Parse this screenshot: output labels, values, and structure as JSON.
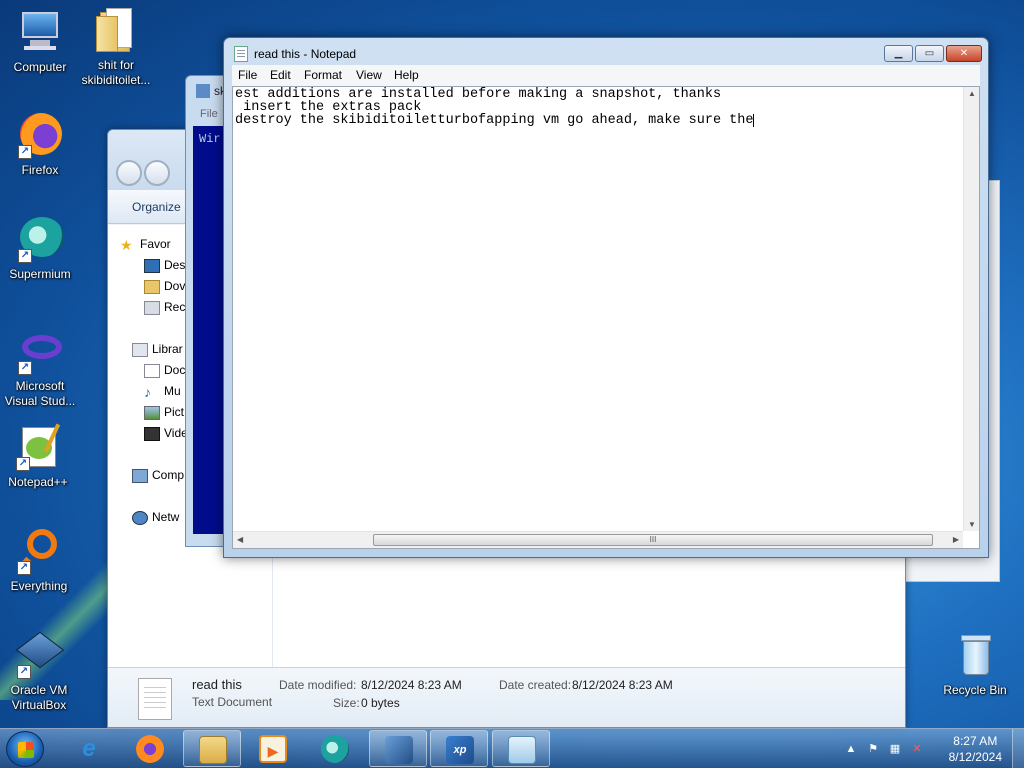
{
  "desktop": {
    "icons": [
      {
        "label": "Computer",
        "icon": "computer-icon"
      },
      {
        "label": "shit for skibiditoilet...",
        "icon": "folder-icon"
      },
      {
        "label": "Firefox",
        "icon": "firefox-icon"
      },
      {
        "label": "Supermium",
        "icon": "supermium-icon"
      },
      {
        "label": "Microsoft Visual Stud...",
        "icon": "visual-studio-icon"
      },
      {
        "label": "Notepad++",
        "icon": "notepadpp-icon"
      },
      {
        "label": "Everything",
        "icon": "everything-icon"
      },
      {
        "label": "Oracle VM VirtualBox",
        "icon": "virtualbox-icon"
      },
      {
        "label": "Recycle Bin",
        "icon": "recycle-bin-icon"
      }
    ]
  },
  "explorer": {
    "toolbar_organize": "Organize",
    "nav": {
      "favorites": "Favor",
      "desktop": "Des",
      "downloads": "Dov",
      "recent": "Rec",
      "libraries": "Librar",
      "documents": "Doc",
      "music": "Mu",
      "pictures": "Pict",
      "videos": "Vide",
      "computer": "Comp",
      "network": "Netw"
    },
    "details": {
      "name": "read this",
      "type": "Text Document",
      "modified_label": "Date modified:",
      "modified_value": "8/12/2024 8:23 AM",
      "created_label": "Date created:",
      "created_value": "8/12/2024 8:23 AM",
      "size_label": "Size:",
      "size_value": "0 bytes"
    }
  },
  "console": {
    "title_partial": "sk",
    "menu_partial": "File",
    "text_partial": "Wir"
  },
  "notepad": {
    "title": "read this - Notepad",
    "menu": [
      "File",
      "Edit",
      "Format",
      "View",
      "Help"
    ],
    "lines": [
      "est additions are installed before making a snapshot, thanks",
      " insert the extras pack",
      "destroy the skibiditoiletturbofapping vm go ahead, make sure the"
    ],
    "hscroll_thumb": "III"
  },
  "taskbar": {
    "apps": [
      {
        "name": "internet-explorer",
        "glyph": "e"
      },
      {
        "name": "firefox",
        "glyph": "🦊"
      },
      {
        "name": "explorer",
        "glyph": "📁"
      },
      {
        "name": "media-player",
        "glyph": "▶"
      },
      {
        "name": "supermium",
        "glyph": "◐"
      },
      {
        "name": "virtualbox",
        "glyph": "▣"
      },
      {
        "name": "windows-xp-vm",
        "glyph": "xp"
      },
      {
        "name": "notepad",
        "glyph": "✎"
      }
    ],
    "clock_time": "8:27 AM",
    "clock_date": "8/12/2024"
  },
  "colors": {
    "accent": "#1f6fc0",
    "console_blue": "#000c8c",
    "close_red": "#c7452a"
  }
}
